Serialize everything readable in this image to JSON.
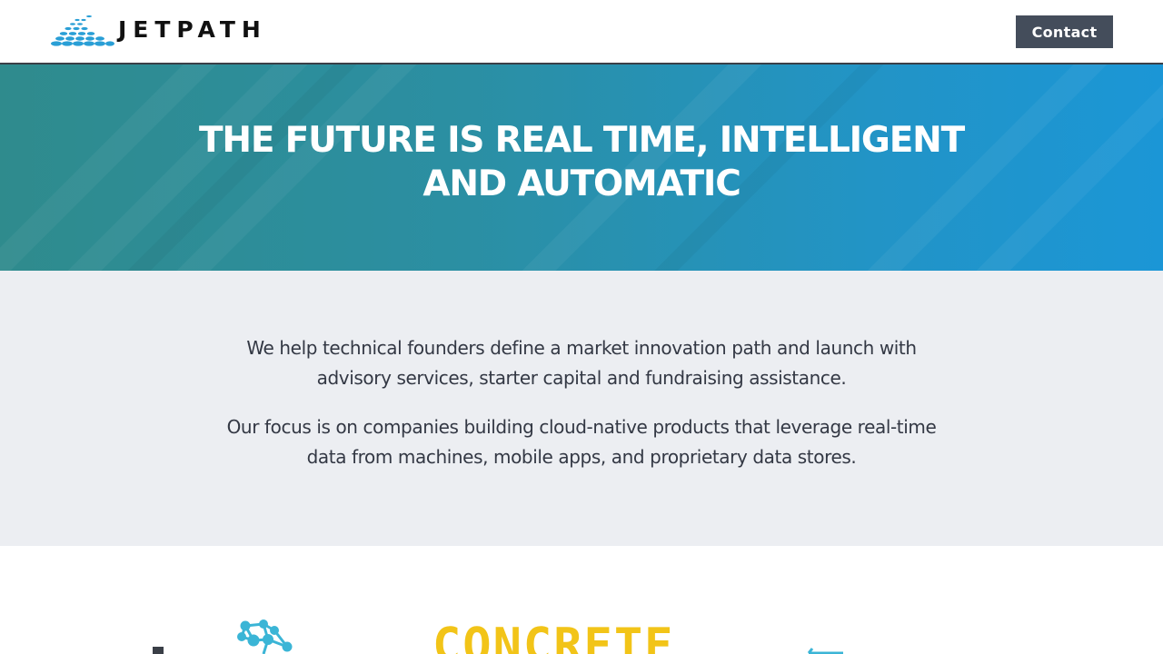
{
  "header": {
    "logo_text": "JETPATH",
    "logo_icon": "jetpath-dome-logo-icon",
    "contact_label": "Contact"
  },
  "hero": {
    "title_line1": "THE FUTURE IS REAL TIME, INTELLIGENT",
    "title_line2": "AND AUTOMATIC"
  },
  "intro": {
    "paragraph1": "We help technical founders define a market innovation path and launch with advisory services, starter capital and fundraising assistance.",
    "paragraph2": "Our focus is on companies building cloud-native products that leverage real-time data from machines, mobile apps, and proprietary data stores."
  },
  "portfolio": {
    "concrete_logo_text": "CONCRETE",
    "network_logo_icon": "network-nodes-logo-icon",
    "partial_logo_icon": "partial-network-logo-icon"
  },
  "colors": {
    "accent": "#1b96d6",
    "hero_start": "#2f8b8d",
    "button_bg": "#444d5b",
    "intro_bg": "#eceef2",
    "concrete_yellow": "#f2c418"
  }
}
